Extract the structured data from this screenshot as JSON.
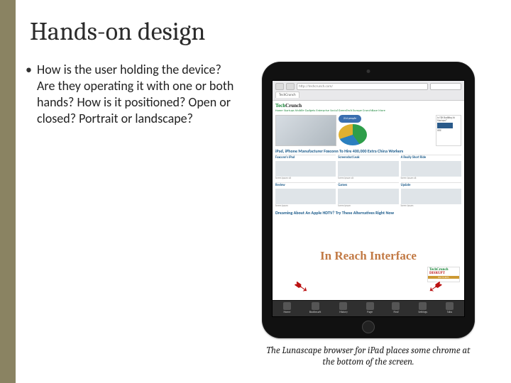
{
  "slide": {
    "title": "Hands-on design",
    "bullet": "How is the user holding the device? Are they operating it with one or both hands? How is it positioned? Open or closed? Portrait or landscape?",
    "caption": "The Lunascape browser for iPad places some chrome at the bottom of the screen.",
    "overlay": "In Reach Interface"
  },
  "browser": {
    "url": "http://techcrunch.com/",
    "tab": "TechCrunch",
    "logo_tech": "Tech",
    "logo_crunch": "Crunch",
    "nav": "Home  Startups  Mobile  Gadgets  Enterprise  Social  GreenTech  Europe  CrunchBase  More",
    "people_pill": "214 people",
    "headline": "iPad, iPhone Manufacturer Foxconn To Hire 400,000 Extra China Workers",
    "alt_headline": "Dreaming About An Apple HDTV? Try These Alternatives Right Now",
    "sidebar_head": "Is Y2K Budding At Startups?",
    "ieee": "IEEE",
    "disrupt_1": "TechCrunch",
    "disrupt_2": "DISRUPT",
    "disrupt_3": "BUY TICKETS",
    "toolbar": {
      "home": "Home",
      "bookmark": "Bookmark",
      "history": "History",
      "page": "Page",
      "find": "Find",
      "settings": "Settings",
      "tabs": "Tabs"
    }
  }
}
